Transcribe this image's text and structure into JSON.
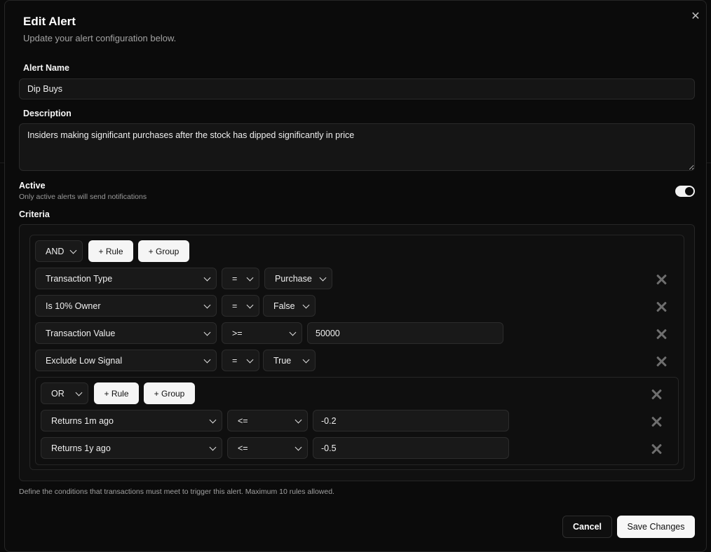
{
  "dialog": {
    "title": "Edit Alert",
    "subtitle": "Update your alert configuration below.",
    "close_icon": "close-icon"
  },
  "form": {
    "name_label": "Alert Name",
    "name_value": "Dip Buys",
    "description_label": "Description",
    "description_value": "Insiders making significant purchases after the stock has dipped significantly in price",
    "active_label": "Active",
    "active_hint": "Only active alerts will send notifications",
    "active_on": true,
    "criteria_label": "Criteria",
    "criteria_hint": "Define the conditions that transactions must meet to trigger this alert. Maximum 10 rules allowed."
  },
  "root_group": {
    "combinator": "AND",
    "add_rule_label": "+ Rule",
    "add_group_label": "+ Group",
    "rules": [
      {
        "field": "Transaction Type",
        "operator": "=",
        "value": "Purchase"
      },
      {
        "field": "Is 10% Owner",
        "operator": "=",
        "value": "False"
      },
      {
        "field": "Transaction Value",
        "operator": ">=",
        "value": "50000"
      },
      {
        "field": "Exclude Low Signal",
        "operator": "=",
        "value": "True"
      }
    ]
  },
  "sub_group": {
    "combinator": "OR",
    "add_rule_label": "+ Rule",
    "add_group_label": "+ Group",
    "rules": [
      {
        "field": "Returns 1m ago",
        "operator": "<=",
        "value": "-0.2"
      },
      {
        "field": "Returns 1y ago",
        "operator": "<=",
        "value": "-0.5"
      }
    ]
  },
  "footer": {
    "cancel_label": "Cancel",
    "save_label": "Save Changes"
  }
}
